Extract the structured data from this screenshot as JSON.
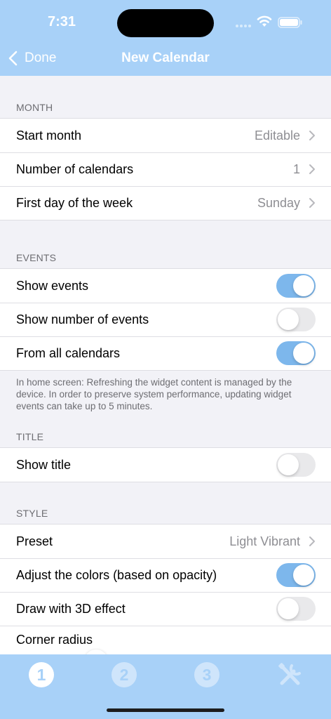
{
  "status": {
    "time": "7:31"
  },
  "nav": {
    "back_label": "Done",
    "title": "New Calendar"
  },
  "sections": {
    "month": {
      "header": "Month",
      "rows": [
        {
          "label": "Start month",
          "value": "Editable"
        },
        {
          "label": "Number of calendars",
          "value": "1"
        },
        {
          "label": "First day of the week",
          "value": "Sunday"
        }
      ]
    },
    "events": {
      "header": "Events",
      "rows": [
        {
          "label": "Show events",
          "on": true
        },
        {
          "label": "Show number of events",
          "on": false
        },
        {
          "label": "From all calendars",
          "on": true
        }
      ],
      "footer": "In home screen: Refreshing the widget content is managed by the device. In order to preserve system performance, updating widget events can take up to 5 minutes."
    },
    "title": {
      "header": "Title",
      "rows": [
        {
          "label": "Show title",
          "on": false
        }
      ]
    },
    "style": {
      "header": "Style",
      "rows": [
        {
          "label": "Preset",
          "value": "Light Vibrant"
        },
        {
          "label": "Adjust the colors (based on opacity)",
          "on": true
        },
        {
          "label": "Draw with 3D effect",
          "on": false
        },
        {
          "label": "Corner radius"
        }
      ]
    }
  },
  "tabs": [
    {
      "name": "tab-1",
      "label": "1",
      "selected": true
    },
    {
      "name": "tab-2",
      "label": "2",
      "selected": false
    },
    {
      "name": "tab-3",
      "label": "3",
      "selected": false
    },
    {
      "name": "tab-tools",
      "icon": "tools-icon",
      "selected": false
    }
  ],
  "colors": {
    "accent": "#a8d1f8",
    "toggle_on": "#7db7ec",
    "background": "#f2f2f7"
  }
}
